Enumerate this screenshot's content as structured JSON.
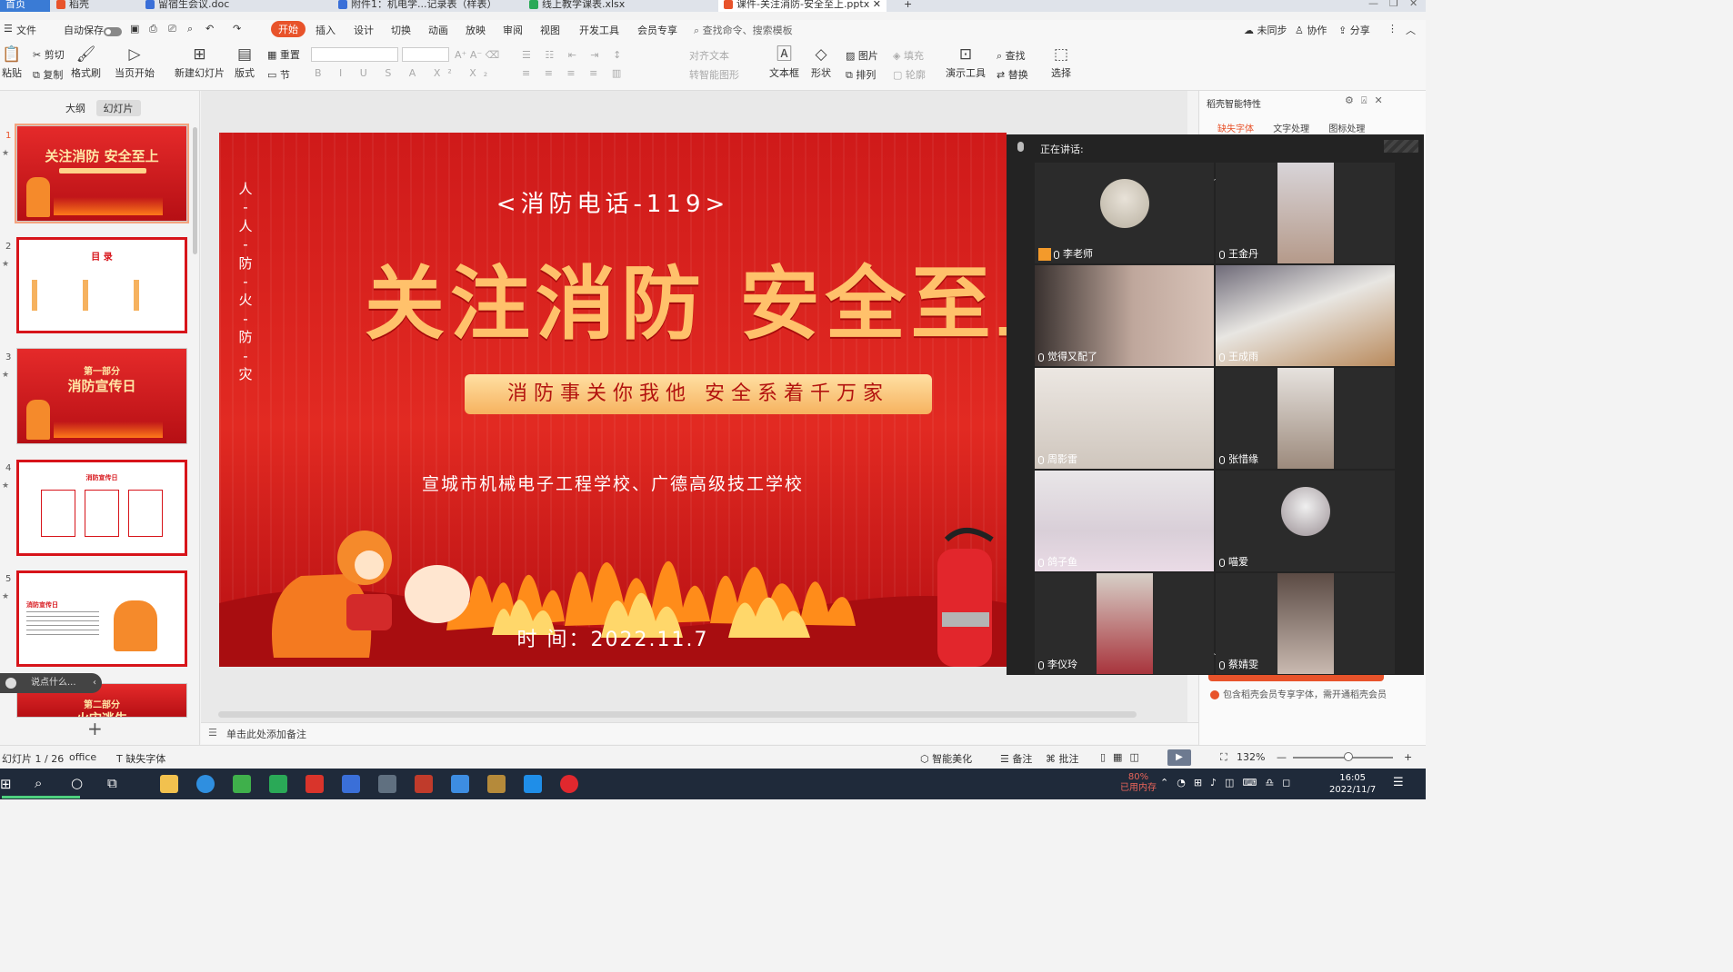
{
  "tabs": {
    "home": "首页",
    "t1": "稻壳",
    "t2": "留宿生会议.doc",
    "t3": "附件1：机电学...记录表（样表）",
    "t4": "线上教学课表.xlsx",
    "t5": "课件-关注消防-安全至上.pptx"
  },
  "menu": {
    "file": "文件",
    "autosave": "自动保存",
    "items": [
      "开始",
      "插入",
      "设计",
      "切换",
      "动画",
      "放映",
      "审阅",
      "视图",
      "开发工具",
      "会员专享"
    ],
    "search": "查找命令、搜索模板",
    "right": [
      "未同步",
      "协作",
      "分享"
    ]
  },
  "ribbon": {
    "paste": "粘贴",
    "cut": "剪切",
    "copy": "复制",
    "format_painter": "格式刷",
    "from_current": "当页开始",
    "new_slide": "新建幻灯片",
    "layout": "版式",
    "reset": "重置",
    "section": "节",
    "align_text": "对齐文本",
    "convert_smartart": "转智能图形",
    "textbox": "文本框",
    "shape": "形状",
    "picture": "图片",
    "arrange": "排列",
    "fill": "填充",
    "outline": "轮廓",
    "present_tools": "演示工具",
    "find": "查找",
    "replace": "替换",
    "select": "选择"
  },
  "left": {
    "tab_outline": "大纲",
    "tab_slides": "幻灯片",
    "thumbs": [
      {
        "num": "1",
        "title": "关注消防 安全至上"
      },
      {
        "num": "2",
        "title": "目 录"
      },
      {
        "num": "3",
        "title_small": "第一部分",
        "title": "消防宣传日"
      },
      {
        "num": "4",
        "title": "消防宣传日"
      },
      {
        "num": "5",
        "title": "消防宣传日"
      },
      {
        "num": "6",
        "title_small": "第二部分",
        "title": "火灾逃生"
      }
    ],
    "chat_placeholder": "说点什么..."
  },
  "slide": {
    "vertical": [
      "人",
      "-",
      "人",
      "-",
      "防",
      "-",
      "火",
      "-",
      "防",
      "-",
      "灾"
    ],
    "hotline": "<消防电话-119>",
    "title": "关注消防  安全至上",
    "subtitle": "消防事关你我他  安全系着千万家",
    "schools": "宣城市机械电子工程学校、广德高级技工学校",
    "date": "时  间：2022.11.7"
  },
  "right_pane": {
    "title": "稻壳智能特性",
    "tabs": [
      "缺失字体",
      "文字处理",
      "图标处理"
    ],
    "note": "包含稻壳会员专享字体，需开通稻壳会员"
  },
  "meeting": {
    "speaking": "正在讲话:",
    "participants": [
      {
        "name": "李老师",
        "host": true
      },
      {
        "name": "王金丹"
      },
      {
        "name": "觉得又配了"
      },
      {
        "name": "王成雨"
      },
      {
        "name": "周影雷"
      },
      {
        "name": "张惜缘"
      },
      {
        "name": "鸽子鱼"
      },
      {
        "name": "喵爱"
      },
      {
        "name": "李仪玲"
      },
      {
        "name": "蔡婧雯"
      }
    ]
  },
  "notes": {
    "placeholder": "单击此处添加备注"
  },
  "status": {
    "slide_counter": "幻灯片 1 / 26",
    "theme": "office",
    "missing_font": "缺失字体",
    "beautify": "智能美化",
    "notes": "备注",
    "comments": "批注",
    "zoom": "132%"
  },
  "taskbar": {
    "memory_pct": "80%",
    "memory_label": "已用内存",
    "time": "16:05",
    "date": "2022/11/7"
  },
  "colors": {
    "accent": "#e8532b",
    "slide_red": "#d81e1e",
    "title_gold": "#ffc16b",
    "meeting_bg": "#232323"
  }
}
